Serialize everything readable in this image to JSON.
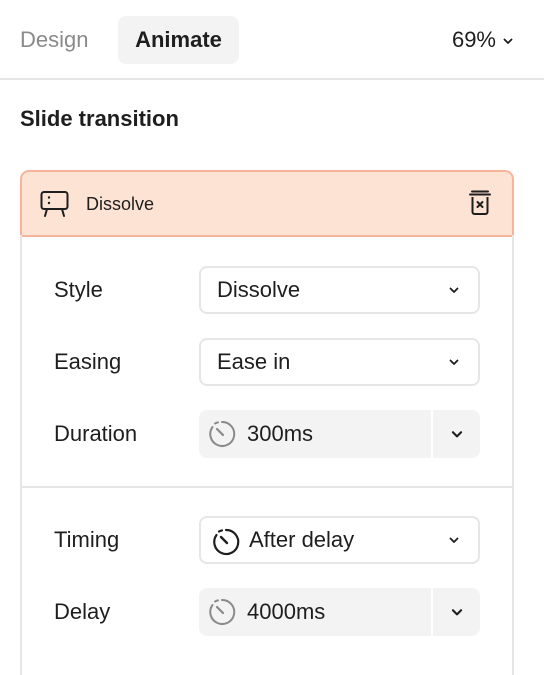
{
  "tabs": {
    "design": "Design",
    "animate": "Animate"
  },
  "zoom": {
    "value": "69%"
  },
  "section_title": "Slide transition",
  "transition": {
    "name": "Dissolve",
    "style": {
      "label": "Style",
      "value": "Dissolve"
    },
    "easing": {
      "label": "Easing",
      "value": "Ease in"
    },
    "duration": {
      "label": "Duration",
      "value": "300ms"
    },
    "timing": {
      "label": "Timing",
      "value": "After delay"
    },
    "delay": {
      "label": "Delay",
      "value": "4000ms"
    }
  },
  "icons": {
    "presentation": "presentation-icon",
    "trash": "trash-icon",
    "stopwatch": "stopwatch-icon",
    "timer": "timer-icon",
    "chevron": "chevron-down-icon"
  },
  "colors": {
    "card_header_bg": "#fde3d4",
    "card_header_border": "#f6b59a",
    "field_bg": "#f3f3f3",
    "border": "#e6e6e6",
    "text": "#1e1e1e",
    "muted": "#8a8a8a"
  }
}
